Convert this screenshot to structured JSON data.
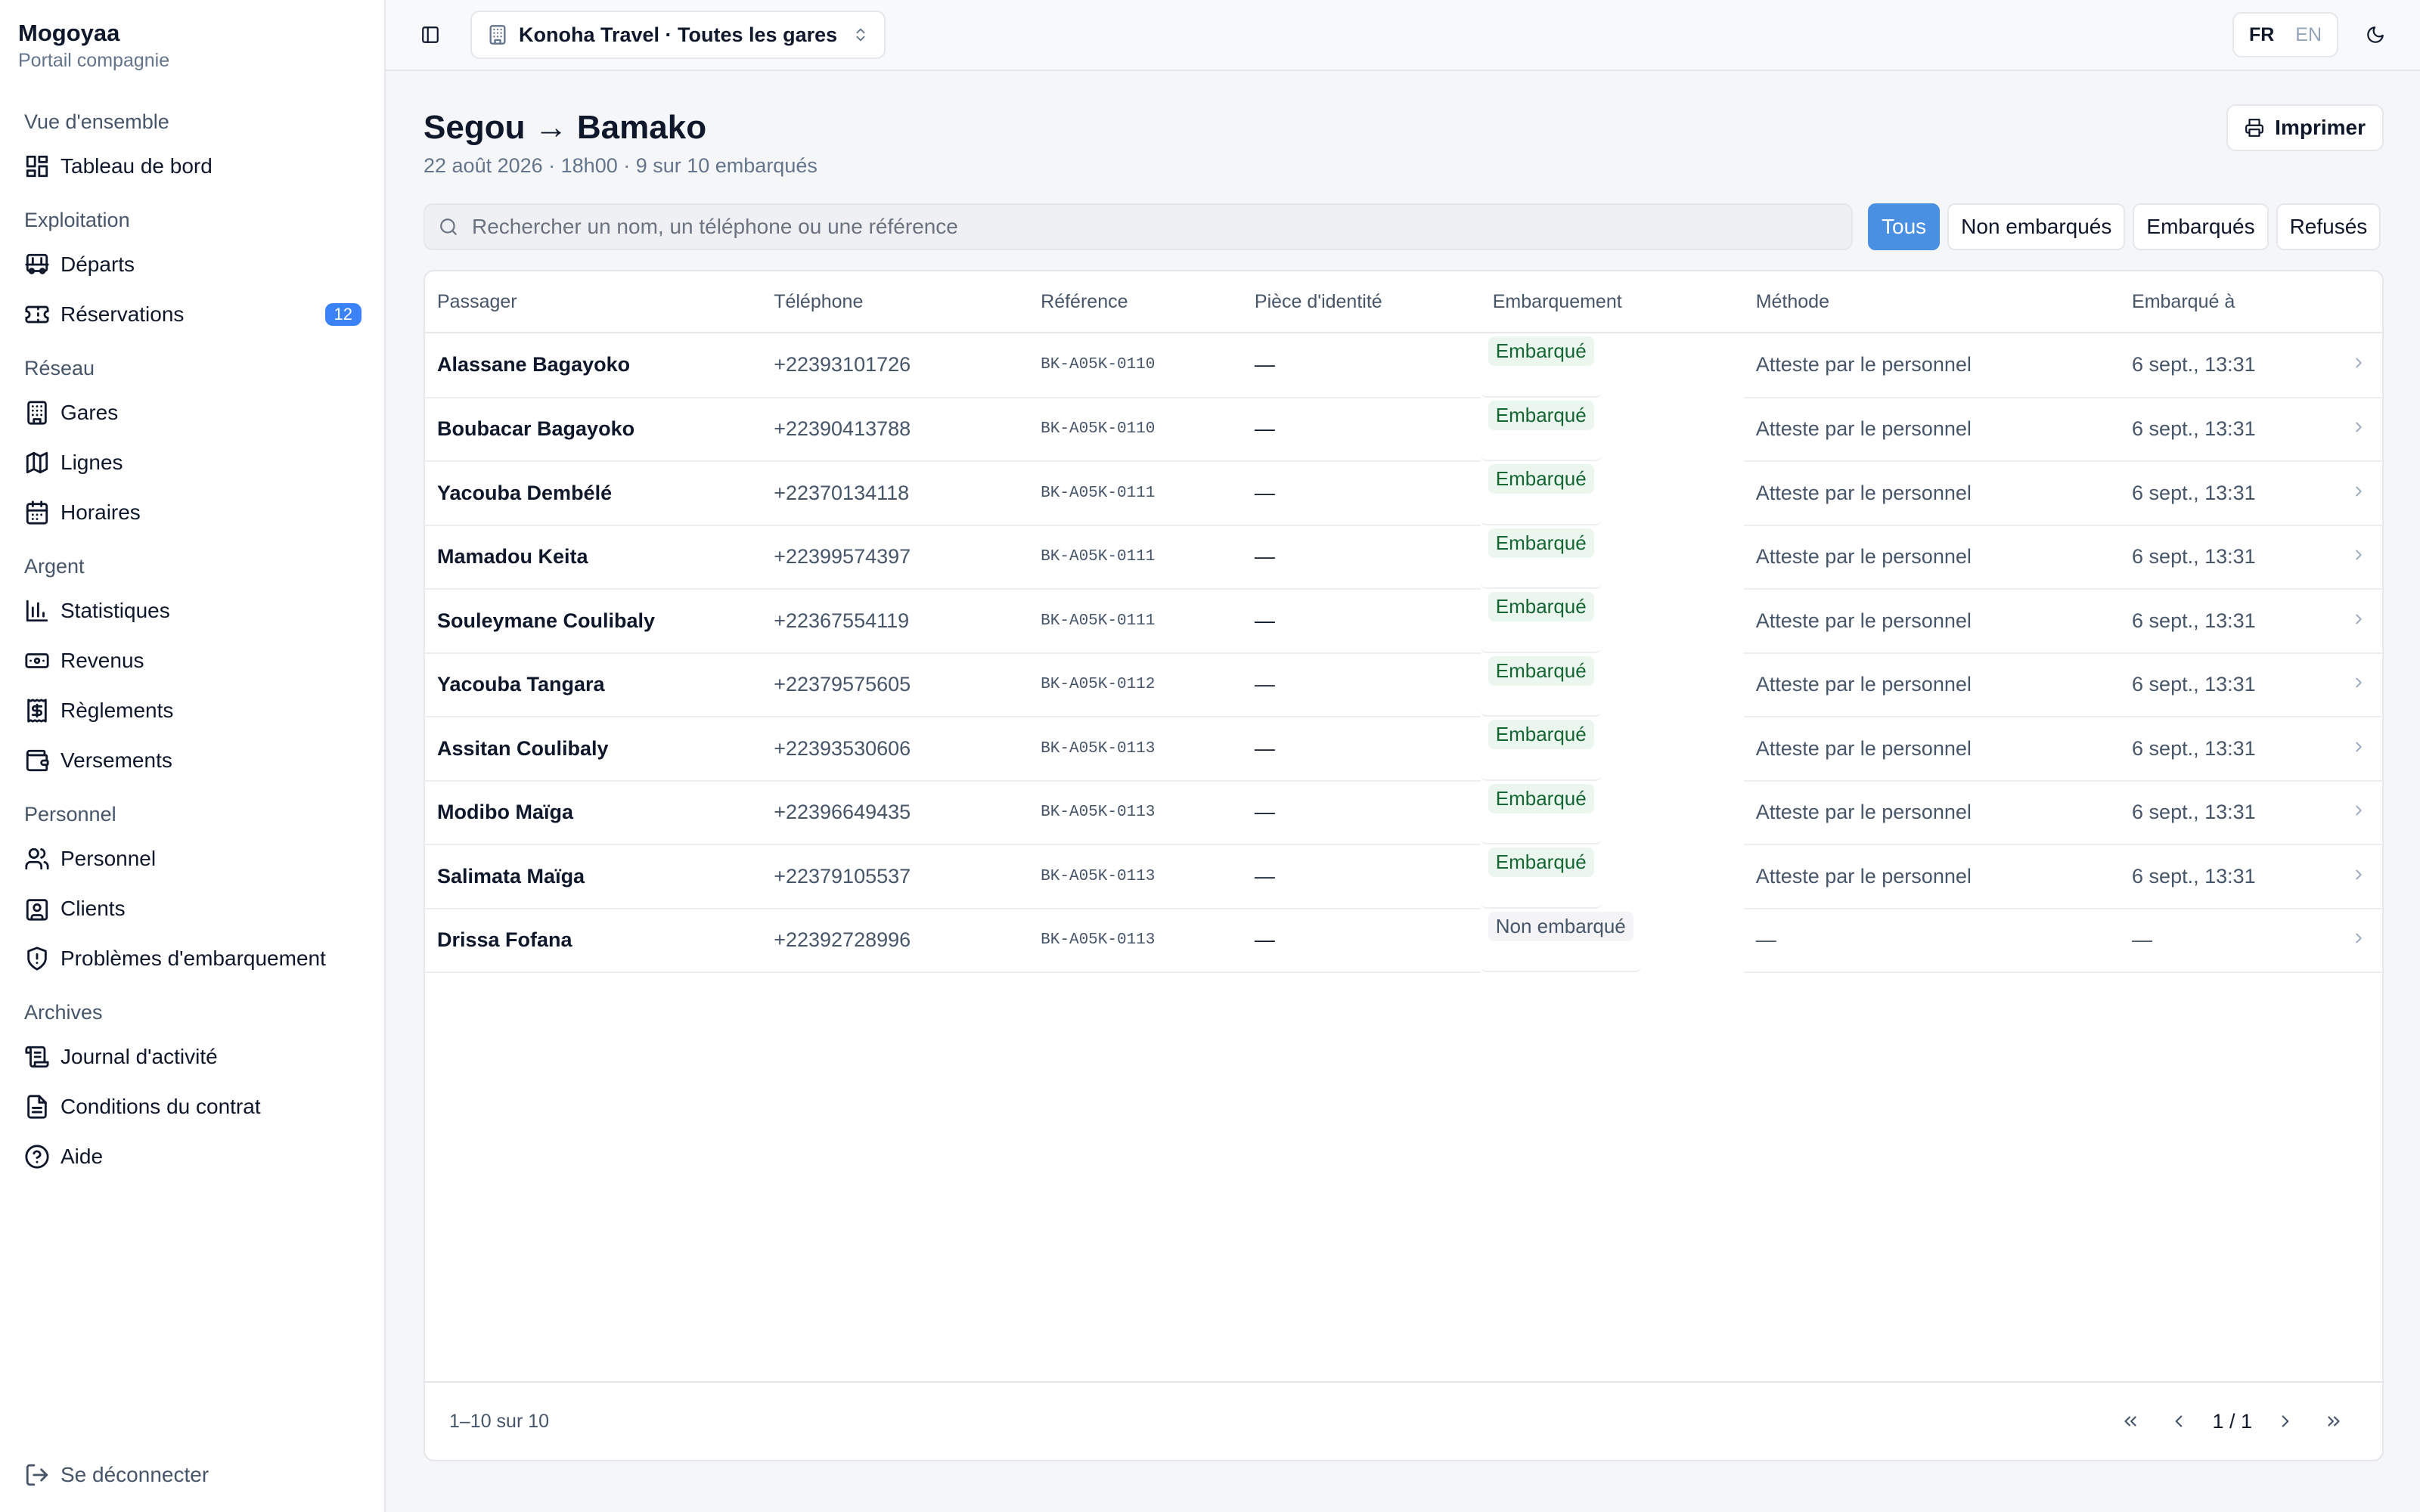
{
  "brand": {
    "name": "Mogoyaa",
    "subtitle": "Portail compagnie"
  },
  "nav": {
    "groups": [
      {
        "label": "Vue d'ensemble",
        "items": [
          {
            "label": "Tableau de bord",
            "icon": "dashboard-icon"
          }
        ]
      },
      {
        "label": "Exploitation",
        "items": [
          {
            "label": "Départs",
            "icon": "bus-icon"
          },
          {
            "label": "Réservations",
            "icon": "ticket-icon",
            "badge": "12"
          }
        ]
      },
      {
        "label": "Réseau",
        "items": [
          {
            "label": "Gares",
            "icon": "building-icon"
          },
          {
            "label": "Lignes",
            "icon": "map-icon"
          },
          {
            "label": "Horaires",
            "icon": "calendar-icon"
          }
        ]
      },
      {
        "label": "Argent",
        "items": [
          {
            "label": "Statistiques",
            "icon": "bar-chart-icon"
          },
          {
            "label": "Revenus",
            "icon": "banknote-icon"
          },
          {
            "label": "Règlements",
            "icon": "receipt-icon"
          },
          {
            "label": "Versements",
            "icon": "wallet-icon"
          }
        ]
      },
      {
        "label": "Personnel",
        "items": [
          {
            "label": "Personnel",
            "icon": "users-icon"
          },
          {
            "label": "Clients",
            "icon": "contact-icon"
          },
          {
            "label": "Problèmes d'embarquement",
            "icon": "shield-alert-icon"
          }
        ]
      },
      {
        "label": "Archives",
        "items": [
          {
            "label": "Journal d'activité",
            "icon": "scroll-icon"
          },
          {
            "label": "Conditions du contrat",
            "icon": "file-text-icon"
          },
          {
            "label": "Aide",
            "icon": "help-circle-icon"
          }
        ]
      }
    ],
    "logout": "Se déconnecter"
  },
  "topbar": {
    "org": "Konoha Travel · Toutes les gares",
    "lang_active": "FR",
    "lang_other": "EN"
  },
  "page": {
    "title": "Segou → Bamako",
    "subtitle": "22 août 2026 · 18h00 · 9 sur 10 embarqués",
    "print_label": "Imprimer"
  },
  "search": {
    "placeholder": "Rechercher un nom, un téléphone ou une référence",
    "value": ""
  },
  "filters": {
    "all": "Tous",
    "not_boarded": "Non embarqués",
    "boarded": "Embarqués",
    "refused": "Refusés"
  },
  "table": {
    "headers": {
      "passenger": "Passager",
      "phone": "Téléphone",
      "reference": "Référence",
      "id": "Pièce d'identité",
      "boarding": "Embarquement",
      "method": "Méthode",
      "boarded_at": "Embarqué à"
    },
    "rows": [
      {
        "name": "Alassane Bagayoko",
        "phone": "+22393101726",
        "ref": "BK-A05K-0110",
        "id": "—",
        "status": "Embarqué",
        "boarded": true,
        "method": "Atteste par le personnel",
        "time": "6 sept., 13:31"
      },
      {
        "name": "Boubacar Bagayoko",
        "phone": "+22390413788",
        "ref": "BK-A05K-0110",
        "id": "—",
        "status": "Embarqué",
        "boarded": true,
        "method": "Atteste par le personnel",
        "time": "6 sept., 13:31"
      },
      {
        "name": "Yacouba Dembélé",
        "phone": "+22370134118",
        "ref": "BK-A05K-0111",
        "id": "—",
        "status": "Embarqué",
        "boarded": true,
        "method": "Atteste par le personnel",
        "time": "6 sept., 13:31"
      },
      {
        "name": "Mamadou Keita",
        "phone": "+22399574397",
        "ref": "BK-A05K-0111",
        "id": "—",
        "status": "Embarqué",
        "boarded": true,
        "method": "Atteste par le personnel",
        "time": "6 sept., 13:31"
      },
      {
        "name": "Souleymane Coulibaly",
        "phone": "+22367554119",
        "ref": "BK-A05K-0111",
        "id": "—",
        "status": "Embarqué",
        "boarded": true,
        "method": "Atteste par le personnel",
        "time": "6 sept., 13:31"
      },
      {
        "name": "Yacouba Tangara",
        "phone": "+22379575605",
        "ref": "BK-A05K-0112",
        "id": "—",
        "status": "Embarqué",
        "boarded": true,
        "method": "Atteste par le personnel",
        "time": "6 sept., 13:31"
      },
      {
        "name": "Assitan Coulibaly",
        "phone": "+22393530606",
        "ref": "BK-A05K-0113",
        "id": "—",
        "status": "Embarqué",
        "boarded": true,
        "method": "Atteste par le personnel",
        "time": "6 sept., 13:31"
      },
      {
        "name": "Modibo Maïga",
        "phone": "+22396649435",
        "ref": "BK-A05K-0113",
        "id": "—",
        "status": "Embarqué",
        "boarded": true,
        "method": "Atteste par le personnel",
        "time": "6 sept., 13:31"
      },
      {
        "name": "Salimata Maïga",
        "phone": "+22379105537",
        "ref": "BK-A05K-0113",
        "id": "—",
        "status": "Embarqué",
        "boarded": true,
        "method": "Atteste par le personnel",
        "time": "6 sept., 13:31"
      },
      {
        "name": "Drissa Fofana",
        "phone": "+22392728996",
        "ref": "BK-A05K-0113",
        "id": "—",
        "status": "Non embarqué",
        "boarded": false,
        "method": "—",
        "time": "—"
      }
    ]
  },
  "pagination": {
    "range": "1–10 sur 10",
    "page": "1 / 1"
  },
  "colors": {
    "accent": "#4a90e2",
    "badge": "#3b82f6",
    "boarded_bg": "#ebf7ee",
    "boarded_text": "#166534"
  }
}
